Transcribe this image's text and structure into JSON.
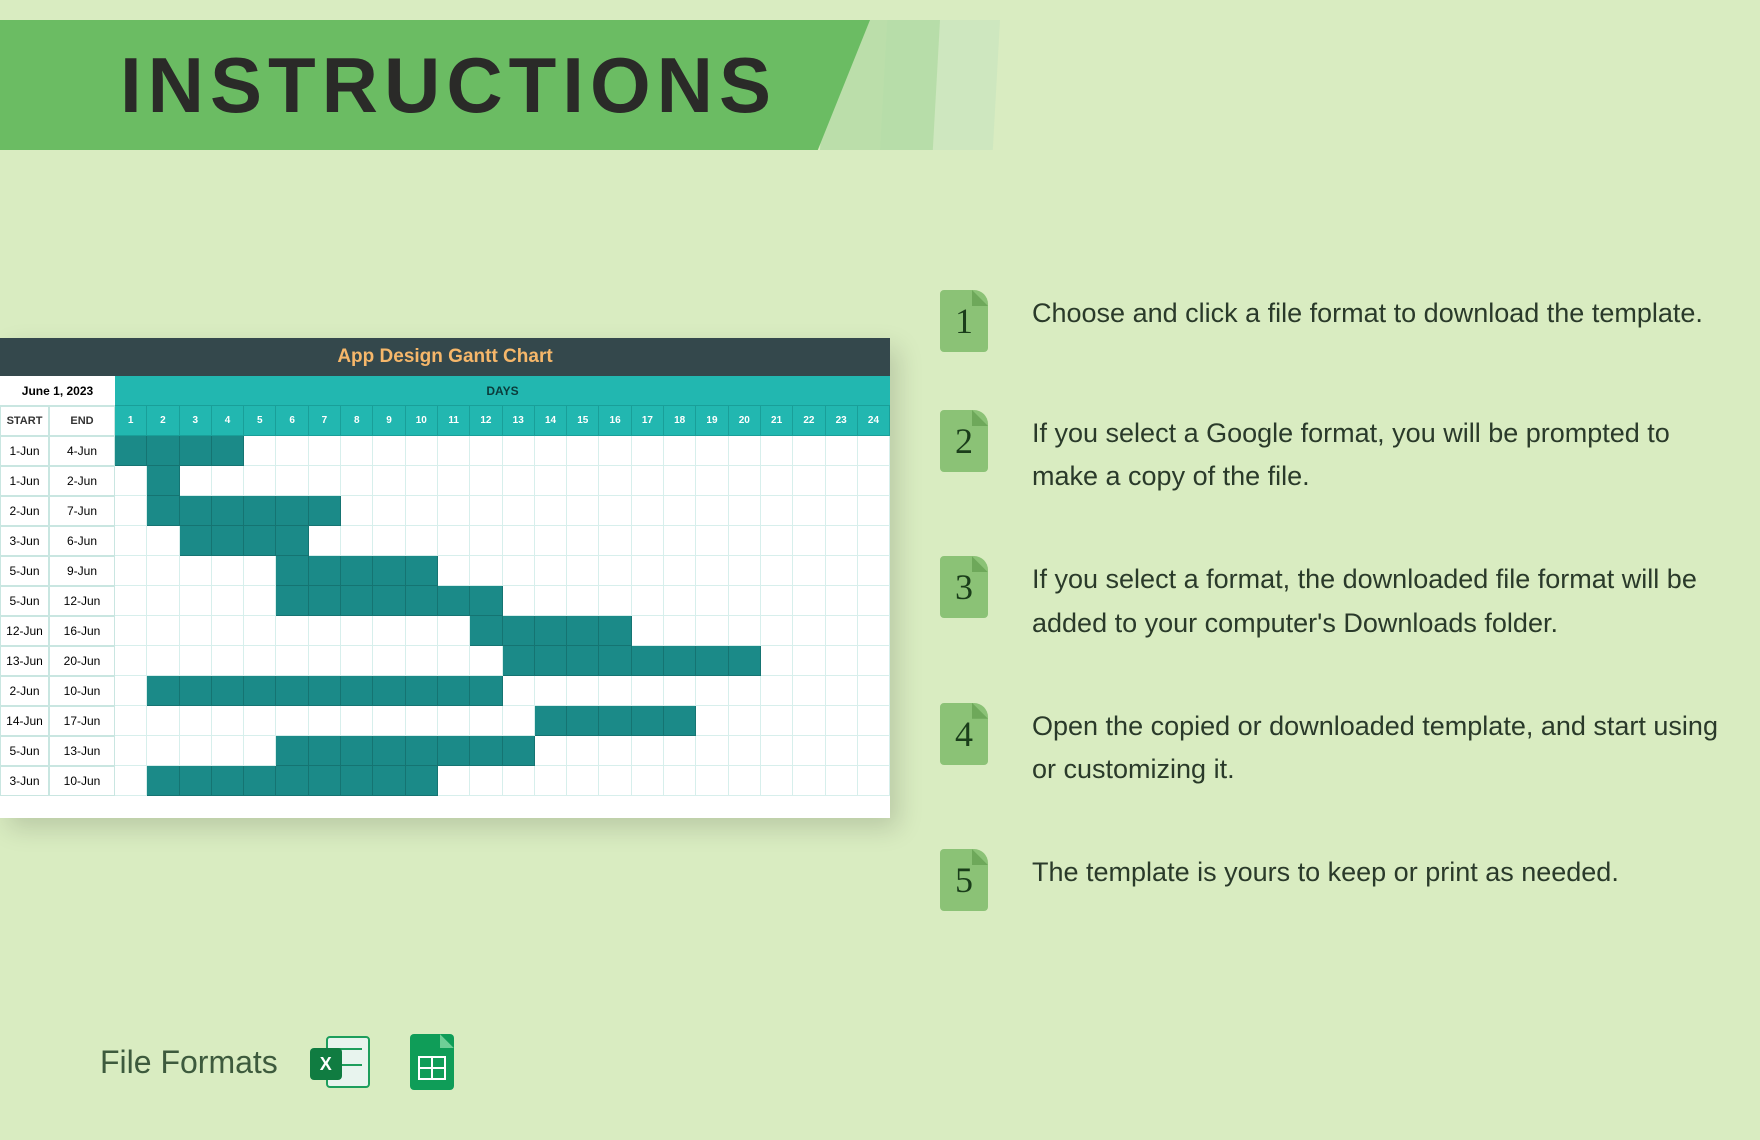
{
  "title": "INSTRUCTIONS",
  "steps": [
    {
      "num": "1",
      "text": "Choose and click a file format to download the template."
    },
    {
      "num": "2",
      "text": "If you select a Google format, you will be prompted to make a copy of the file."
    },
    {
      "num": "3",
      "text": "If you select a format, the downloaded file format will be added to your computer's Downloads folder."
    },
    {
      "num": "4",
      "text": "Open the copied or downloaded template, and start using or customizing it."
    },
    {
      "num": "5",
      "text": "The template is yours to keep or print as needed."
    }
  ],
  "file_formats_label": "File Formats",
  "gantt": {
    "title": "App Design Gantt Chart",
    "project_date": "June 1, 2023",
    "days_label": "DAYS",
    "col_start": "START",
    "col_end": "END",
    "day_numbers": [
      "1",
      "2",
      "3",
      "4",
      "5",
      "6",
      "7",
      "8",
      "9",
      "10",
      "11",
      "12",
      "13",
      "14",
      "15",
      "16",
      "17",
      "18",
      "19",
      "20",
      "21",
      "22",
      "23",
      "24"
    ],
    "rows": [
      {
        "start": "1-Jun",
        "end": "4-Jun",
        "from": 1,
        "to": 4
      },
      {
        "start": "1-Jun",
        "end": "2-Jun",
        "from": 2,
        "to": 2
      },
      {
        "start": "2-Jun",
        "end": "7-Jun",
        "from": 2,
        "to": 7
      },
      {
        "start": "3-Jun",
        "end": "6-Jun",
        "from": 3,
        "to": 6
      },
      {
        "start": "5-Jun",
        "end": "9-Jun",
        "from": 6,
        "to": 10
      },
      {
        "start": "5-Jun",
        "end": "12-Jun",
        "from": 6,
        "to": 12
      },
      {
        "start": "12-Jun",
        "end": "16-Jun",
        "from": 12,
        "to": 16
      },
      {
        "start": "13-Jun",
        "end": "20-Jun",
        "from": 13,
        "to": 20
      },
      {
        "start": "2-Jun",
        "end": "10-Jun",
        "from": 2,
        "to": 12
      },
      {
        "start": "14-Jun",
        "end": "17-Jun",
        "from": 14,
        "to": 18
      },
      {
        "start": "5-Jun",
        "end": "13-Jun",
        "from": 6,
        "to": 13
      },
      {
        "start": "3-Jun",
        "end": "10-Jun",
        "from": 2,
        "to": 10
      }
    ]
  },
  "chart_data": {
    "type": "gantt",
    "title": "App Design Gantt Chart",
    "xlabel": "DAYS",
    "x_range": [
      1,
      24
    ],
    "tasks": [
      {
        "start_label": "1-Jun",
        "end_label": "4-Jun",
        "bar_start_day": 1,
        "bar_end_day": 4
      },
      {
        "start_label": "1-Jun",
        "end_label": "2-Jun",
        "bar_start_day": 2,
        "bar_end_day": 2
      },
      {
        "start_label": "2-Jun",
        "end_label": "7-Jun",
        "bar_start_day": 2,
        "bar_end_day": 7
      },
      {
        "start_label": "3-Jun",
        "end_label": "6-Jun",
        "bar_start_day": 3,
        "bar_end_day": 6
      },
      {
        "start_label": "5-Jun",
        "end_label": "9-Jun",
        "bar_start_day": 6,
        "bar_end_day": 10
      },
      {
        "start_label": "5-Jun",
        "end_label": "12-Jun",
        "bar_start_day": 6,
        "bar_end_day": 12
      },
      {
        "start_label": "12-Jun",
        "end_label": "16-Jun",
        "bar_start_day": 12,
        "bar_end_day": 16
      },
      {
        "start_label": "13-Jun",
        "end_label": "20-Jun",
        "bar_start_day": 13,
        "bar_end_day": 20
      },
      {
        "start_label": "2-Jun",
        "end_label": "10-Jun",
        "bar_start_day": 2,
        "bar_end_day": 12
      },
      {
        "start_label": "14-Jun",
        "end_label": "17-Jun",
        "bar_start_day": 14,
        "bar_end_day": 18
      },
      {
        "start_label": "5-Jun",
        "end_label": "13-Jun",
        "bar_start_day": 6,
        "bar_end_day": 13
      },
      {
        "start_label": "3-Jun",
        "end_label": "10-Jun",
        "bar_start_day": 2,
        "bar_end_day": 10
      }
    ]
  }
}
